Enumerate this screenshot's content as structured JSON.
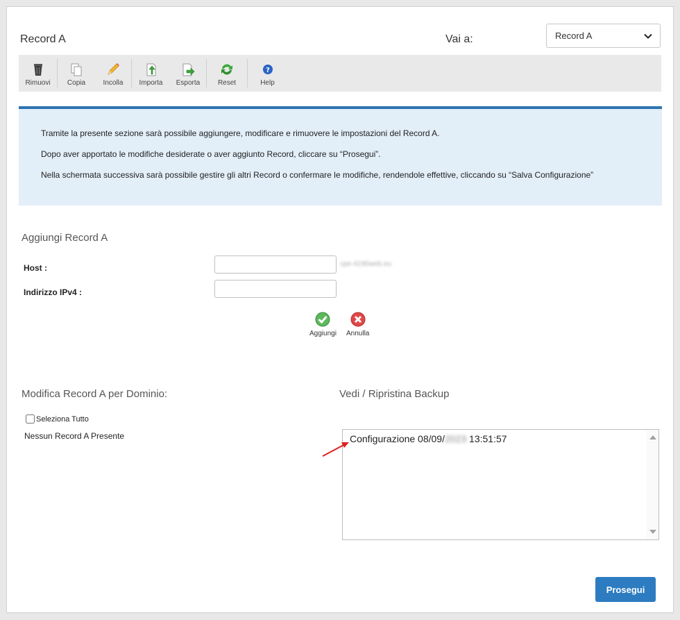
{
  "header": {
    "title": "Record A",
    "goto_label": "Vai a:",
    "goto_selected": "Record A"
  },
  "toolbar": {
    "items": [
      {
        "label": "Rimuovi",
        "icon": "trash-icon"
      },
      {
        "label": "Copia",
        "icon": "copy-icon"
      },
      {
        "label": "Incolla",
        "icon": "pencil-icon"
      },
      {
        "label": "Importa",
        "icon": "import-icon"
      },
      {
        "label": "Esporta",
        "icon": "export-icon"
      },
      {
        "label": "Reset",
        "icon": "refresh-icon"
      },
      {
        "label": "Help",
        "icon": "help-icon"
      }
    ]
  },
  "info": {
    "lines": [
      "Tramite la presente sezione sarà possibile aggiungere, modificare e rimuovere le impostazioni del Record A.",
      "Dopo aver apportato le modifiche desiderate o aver aggiunto Record, cliccare su “Prosegui”.",
      "Nella schermata successiva sarà possibile gestire gli altri Record o confermare le modifiche, rendendole effettive, cliccando su “Salva Configurazione”"
    ]
  },
  "add_form": {
    "title": "Aggiungi Record A",
    "host_label": "Host :",
    "host_value": "",
    "host_suffix": "cpe-4190web.eu",
    "ipv4_label": "Indirizzo IPv4 :",
    "ipv4_value": "",
    "add_label": "Aggiungi",
    "cancel_label": "Annulla"
  },
  "modify": {
    "title": "Modifica Record A per Dominio:",
    "select_all_label": "Seleziona Tutto",
    "empty_text": "Nessun Record A Presente"
  },
  "backup": {
    "title": "Vedi / Ripristina Backup",
    "entry_prefix": "Configurazione 08/09/",
    "entry_year": "2023",
    "entry_time": " 13:51:57"
  },
  "footer": {
    "proceed_label": "Prosegui"
  },
  "colors": {
    "accent": "#2d7cc1",
    "info_bg": "#e2eef8",
    "info_border": "#2e74b0",
    "annotation_arrow": "#e02020"
  }
}
